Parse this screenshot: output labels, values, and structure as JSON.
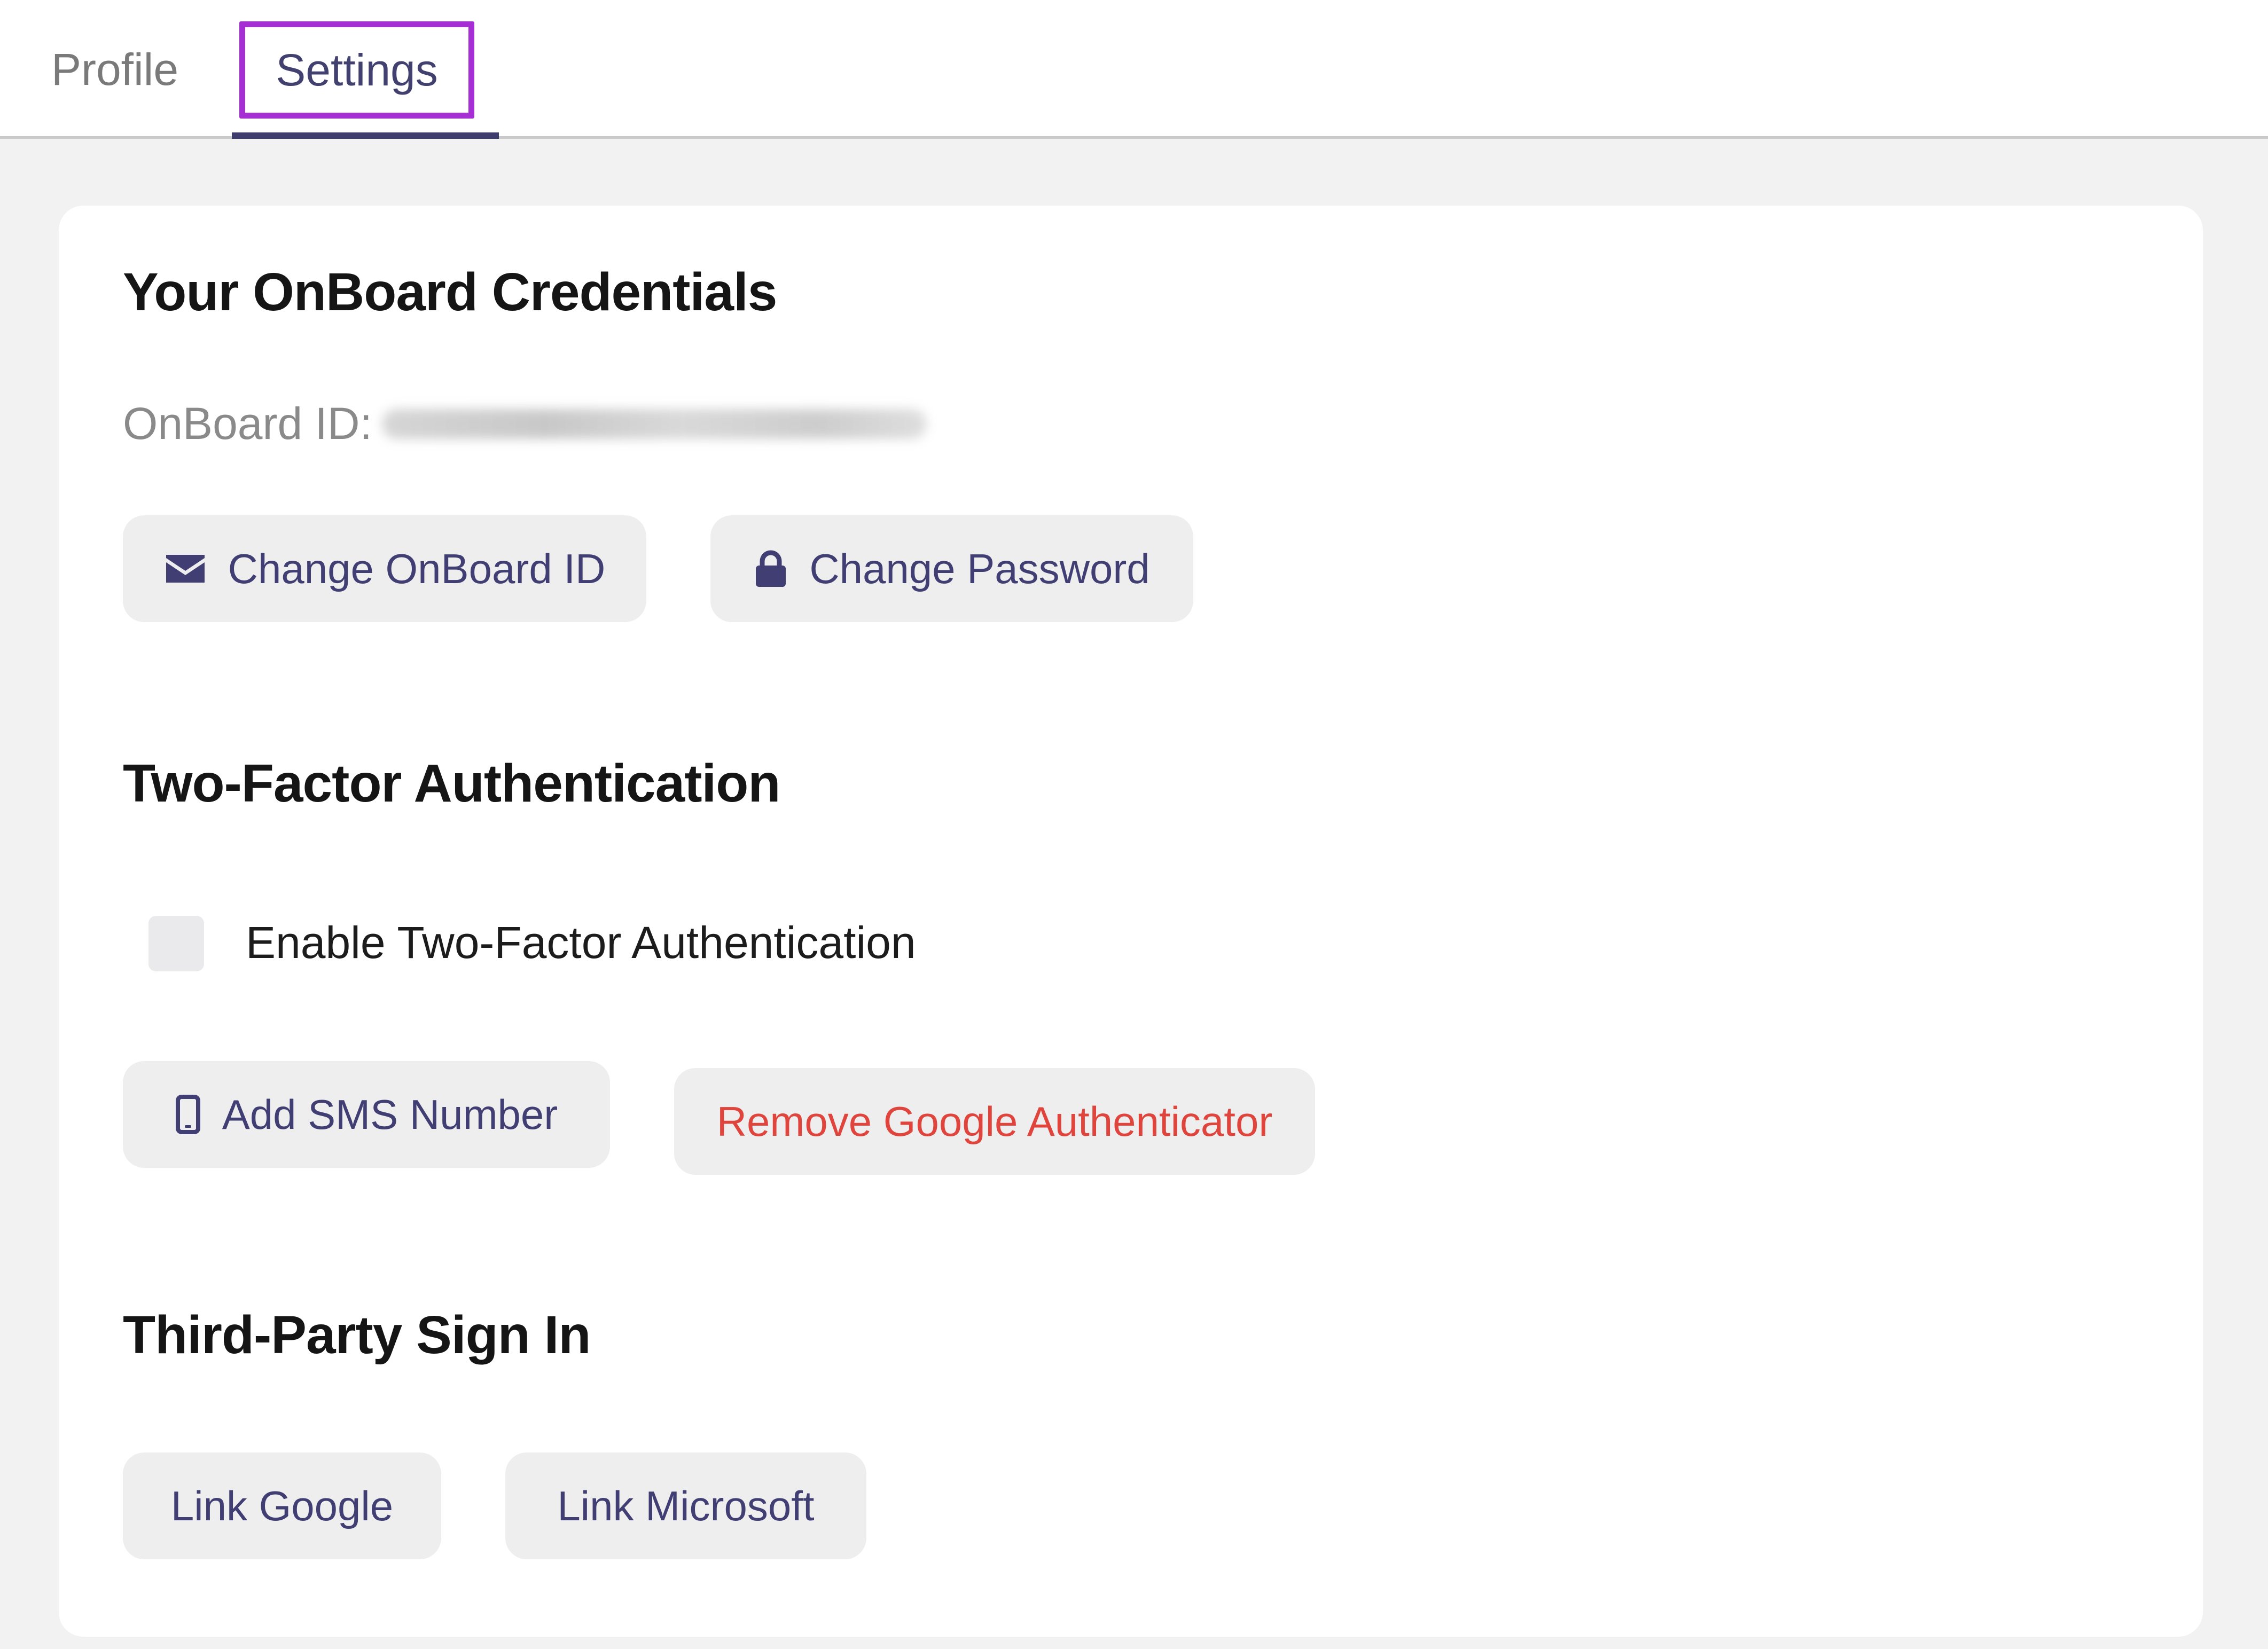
{
  "tabs": [
    {
      "label": "Profile",
      "active": false
    },
    {
      "label": "Settings",
      "active": true
    }
  ],
  "credentials": {
    "title": "Your OnBoard Credentials",
    "id_label": "OnBoard ID:",
    "change_id_label": "Change OnBoard ID",
    "change_password_label": "Change Password"
  },
  "two_factor": {
    "title": "Two-Factor Authentication",
    "enable_label": "Enable Two-Factor Authentication",
    "enabled": false,
    "add_sms_label": "Add SMS Number",
    "remove_google_label": "Remove Google Authenticator"
  },
  "third_party": {
    "title": "Third-Party Sign In",
    "link_google_label": "Link Google",
    "link_microsoft_label": "Link Microsoft"
  },
  "colors": {
    "accent": "#403e72",
    "danger": "#e0453d",
    "highlight": "#a52fd3"
  },
  "icons": {
    "change_id": "envelope-icon",
    "change_password": "lock-icon",
    "add_sms": "mobile-phone-icon"
  }
}
